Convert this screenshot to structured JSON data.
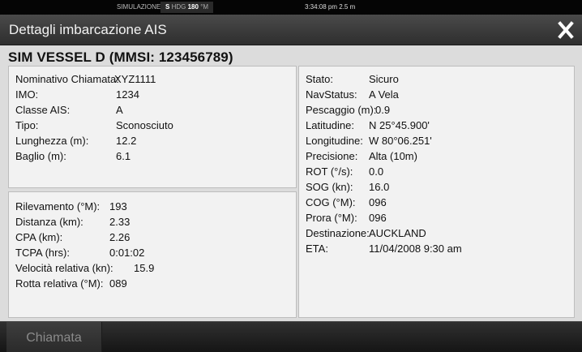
{
  "statusbar": {
    "sim": "SIMULAZIONE...",
    "hdg_s": "S",
    "hdg_label": "HDG",
    "hdg_value": "180",
    "hdg_unit": "°M",
    "time": "3:34:08 pm  2.5 m"
  },
  "window": {
    "title": "Dettagli imbarcazione AIS",
    "close_icon": "close-icon"
  },
  "vessel_title": "SIM VESSEL D (MMSI: 123456789)",
  "identity": [
    {
      "label": "Nominativo Chiamata:",
      "value": "XYZ1111"
    },
    {
      "label": "IMO:",
      "value": "1234"
    },
    {
      "label": "Classe AIS:",
      "value": "A"
    },
    {
      "label": "Tipo:",
      "value": "Sconosciuto"
    },
    {
      "label": "Lunghezza (m):",
      "value": "12.2"
    },
    {
      "label": "Baglio (m):",
      "value": "6.1"
    }
  ],
  "navigation": [
    {
      "label": "Rilevamento (°M):",
      "value": "193"
    },
    {
      "label": "Distanza (km):",
      "value": "2.33"
    },
    {
      "label": "CPA (km):",
      "value": "2.26"
    },
    {
      "label": "TCPA (hrs):",
      "value": "0:01:02"
    },
    {
      "label": "Velocità relativa (kn):",
      "value": "15.9"
    },
    {
      "label": "Rotta relativa (°M):",
      "value": "089"
    }
  ],
  "status": [
    {
      "label": "Stato:",
      "value": "Sicuro"
    },
    {
      "label": "NavStatus:",
      "value": "A Vela"
    },
    {
      "label": "Pescaggio (m):",
      "value": "0.9"
    },
    {
      "label": "Latitudine:",
      "value": "N  25°45.900'"
    },
    {
      "label": "Longitudine:",
      "value": "W  80°06.251'"
    },
    {
      "label": "Precisione:",
      "value": "Alta (10m)"
    },
    {
      "label": "ROT (°/s):",
      "value": "0.0"
    },
    {
      "label": "SOG (kn):",
      "value": "16.0"
    },
    {
      "label": "COG (°M):",
      "value": "096"
    },
    {
      "label": "Prora (°M):",
      "value": "096"
    },
    {
      "label": "Destinazione:",
      "value": "AUCKLAND"
    },
    {
      "label": "ETA:",
      "value": "11/04/2008 9:30 am"
    }
  ],
  "bottombar": {
    "call_button": "Chiamata"
  },
  "colors": {
    "titlebar": "#3a3a3a",
    "panel": "#f2f2f2",
    "background": "#dcdcdc"
  }
}
